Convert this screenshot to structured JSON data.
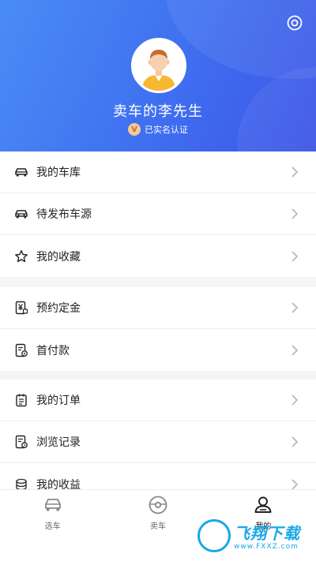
{
  "profile": {
    "username": "卖车的李先生",
    "verified_badge": "V",
    "verified_text": "已实名认证",
    "settings_icon": "settings-ring-icon",
    "avatar_icon": "user-avatar"
  },
  "menu_groups": [
    [
      {
        "label": "我的车库",
        "icon": "car-icon"
      },
      {
        "label": "待发布车源",
        "icon": "car-pending-icon"
      },
      {
        "label": "我的收藏",
        "icon": "star-icon"
      }
    ],
    [
      {
        "label": "预约定金",
        "icon": "yen-deposit-icon"
      },
      {
        "label": "首付款",
        "icon": "down-payment-icon"
      }
    ],
    [
      {
        "label": "我的订单",
        "icon": "order-clipboard-icon"
      },
      {
        "label": "浏览记录",
        "icon": "history-icon"
      },
      {
        "label": "我的收益",
        "icon": "coins-icon"
      }
    ]
  ],
  "tabbar": {
    "tabs": [
      {
        "label": "选车",
        "icon": "car-select-icon"
      },
      {
        "label": "卖车",
        "icon": "sell-car-icon"
      },
      {
        "label": "我的",
        "icon": "person-icon",
        "active": true
      }
    ]
  },
  "watermark": {
    "text": "飞翔下载",
    "url": "www.FXXZ.com"
  },
  "colors": {
    "header_gradient_start": "#4a8cf5",
    "header_gradient_end": "#3d55e6",
    "watermark": "#1aa7e8"
  }
}
